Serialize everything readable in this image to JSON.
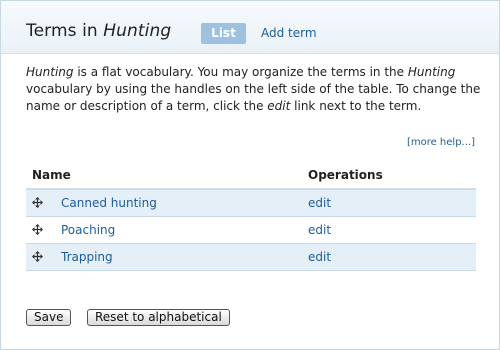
{
  "header": {
    "title_prefix": "Terms in ",
    "title_vocab": "Hunting",
    "tabs": [
      {
        "label": "List",
        "active": true
      },
      {
        "label": "Add term",
        "active": false
      }
    ]
  },
  "description": {
    "vocab_1": "Hunting",
    "text_1": " is a flat vocabulary. You may organize the terms in the ",
    "vocab_2": "Hunting",
    "text_2": " vocabulary by using the handles on the left side of the table. To change the name or description of a term, click the ",
    "edit_word": "edit",
    "text_3": " link next to the term."
  },
  "more_help": "[more help...]",
  "table": {
    "columns": [
      "Name",
      "Operations"
    ],
    "rows": [
      {
        "name": "Canned hunting",
        "operation": "edit"
      },
      {
        "name": "Poaching",
        "operation": "edit"
      },
      {
        "name": "Trapping",
        "operation": "edit"
      }
    ]
  },
  "buttons": {
    "save": "Save",
    "reset": "Reset to alphabetical"
  },
  "colors": {
    "link": "#1f5c99",
    "active_tab": "#9ec1e2",
    "row_highlight": "#e4eff8"
  },
  "icons": {
    "drag_handle": "move-arrows-icon"
  }
}
